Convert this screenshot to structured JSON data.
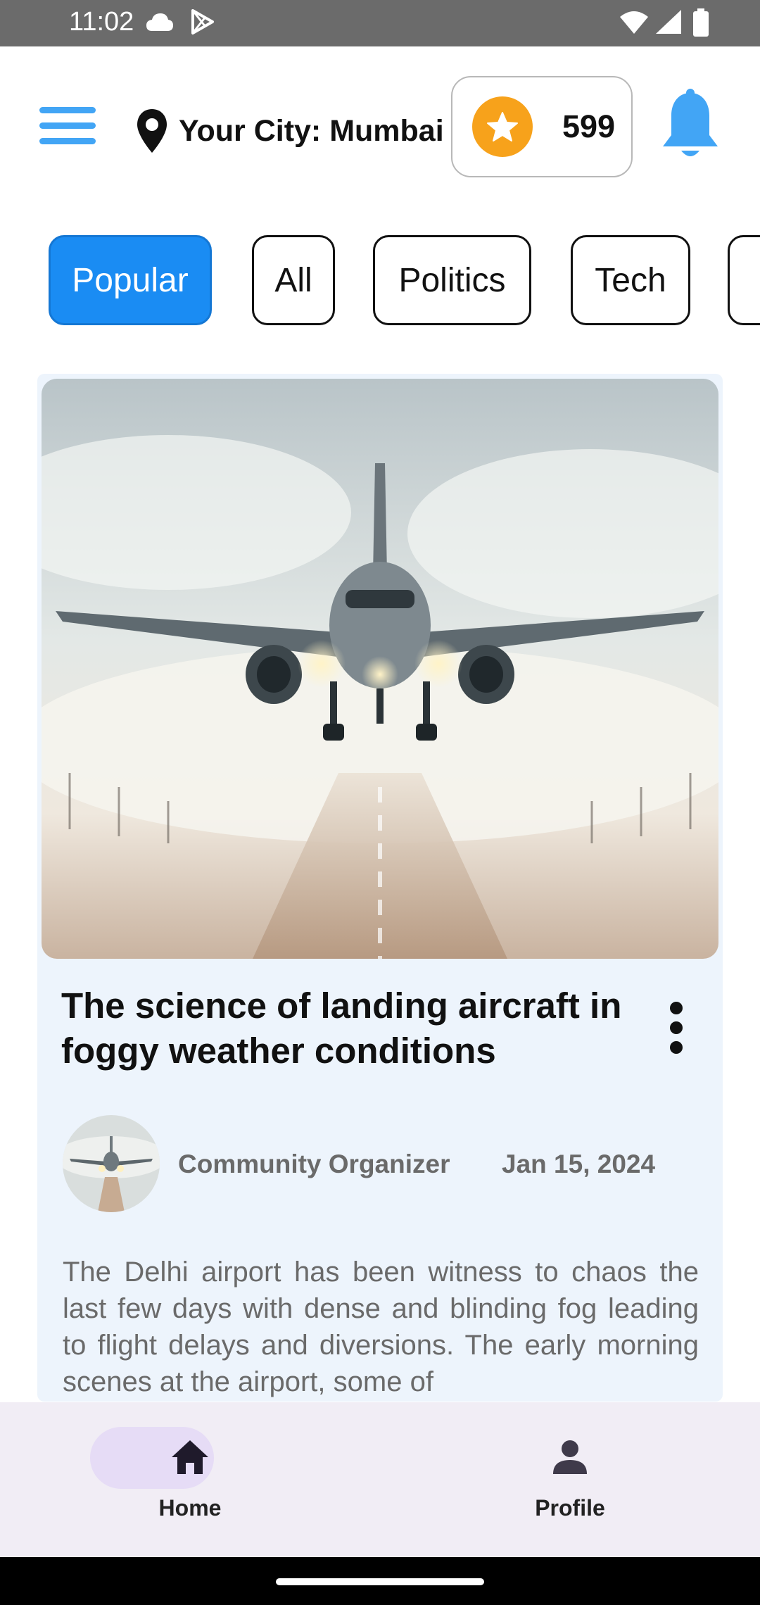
{
  "status_bar": {
    "time": "11:02"
  },
  "header": {
    "location_label": "Your City: Mumbai",
    "points": "599"
  },
  "categories": [
    {
      "label": "Popular",
      "active": true
    },
    {
      "label": "All",
      "active": false
    },
    {
      "label": "Politics",
      "active": false
    },
    {
      "label": "Tech",
      "active": false
    }
  ],
  "article": {
    "title": "The science of landing aircraft in foggy weather conditions",
    "author": "Community Organizer",
    "date": "Jan 15, 2024",
    "excerpt": "The Delhi airport has been witness to chaos the last few days with dense and blinding fog leading to flight delays and diversions. The early morning scenes at the airport, some of"
  },
  "bottom_nav": {
    "items": [
      {
        "label": "Home",
        "icon": "home-icon",
        "active": true
      },
      {
        "label": "Profile",
        "icon": "person-icon",
        "active": false
      }
    ]
  },
  "colors": {
    "accent": "#1a8cf3",
    "menu": "#42a5f5",
    "points_star": "#f7a21b",
    "card_bg": "#edf4fc",
    "nav_bg": "#f1edf5",
    "nav_active_pill": "#e6dcf6"
  }
}
